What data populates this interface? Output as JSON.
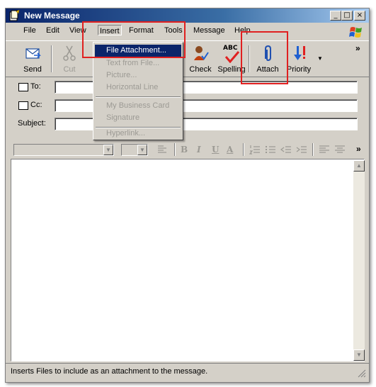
{
  "window": {
    "title": "New Message"
  },
  "caption_buttons": {
    "minimize": "_",
    "maximize": "□",
    "close": "×"
  },
  "menubar": [
    "File",
    "Edit",
    "View",
    "Insert",
    "Format",
    "Tools",
    "Message",
    "Help"
  ],
  "toolbar": {
    "send": "Send",
    "cut": "Cut",
    "check": "Check",
    "spelling": "Spelling",
    "spelling_abc": "ABC",
    "attach": "Attach",
    "priority": "Priority",
    "overflow": "»"
  },
  "header": {
    "to_label": "To:",
    "cc_label": "Cc:",
    "subject_label": "Subject:",
    "to_value": "",
    "cc_value": "",
    "subject_value": ""
  },
  "format_toolbar": {
    "bold": "B",
    "italic": "I",
    "underline": "U",
    "font_color": "A",
    "overflow": "»"
  },
  "insert_menu": {
    "items": [
      "File Attachment...",
      "Text from File...",
      "Picture...",
      "Horizontal Line",
      "My Business Card",
      "Signature",
      "Hyperlink..."
    ],
    "selected": "File Attachment..."
  },
  "status": {
    "text": "Inserts Files to include as an attachment to the message."
  },
  "colors": {
    "title_start": "#0a246a",
    "title_end": "#a6caf0",
    "face": "#d4d0c8",
    "highlight": "#0a246a",
    "annotation": "#e02020"
  }
}
